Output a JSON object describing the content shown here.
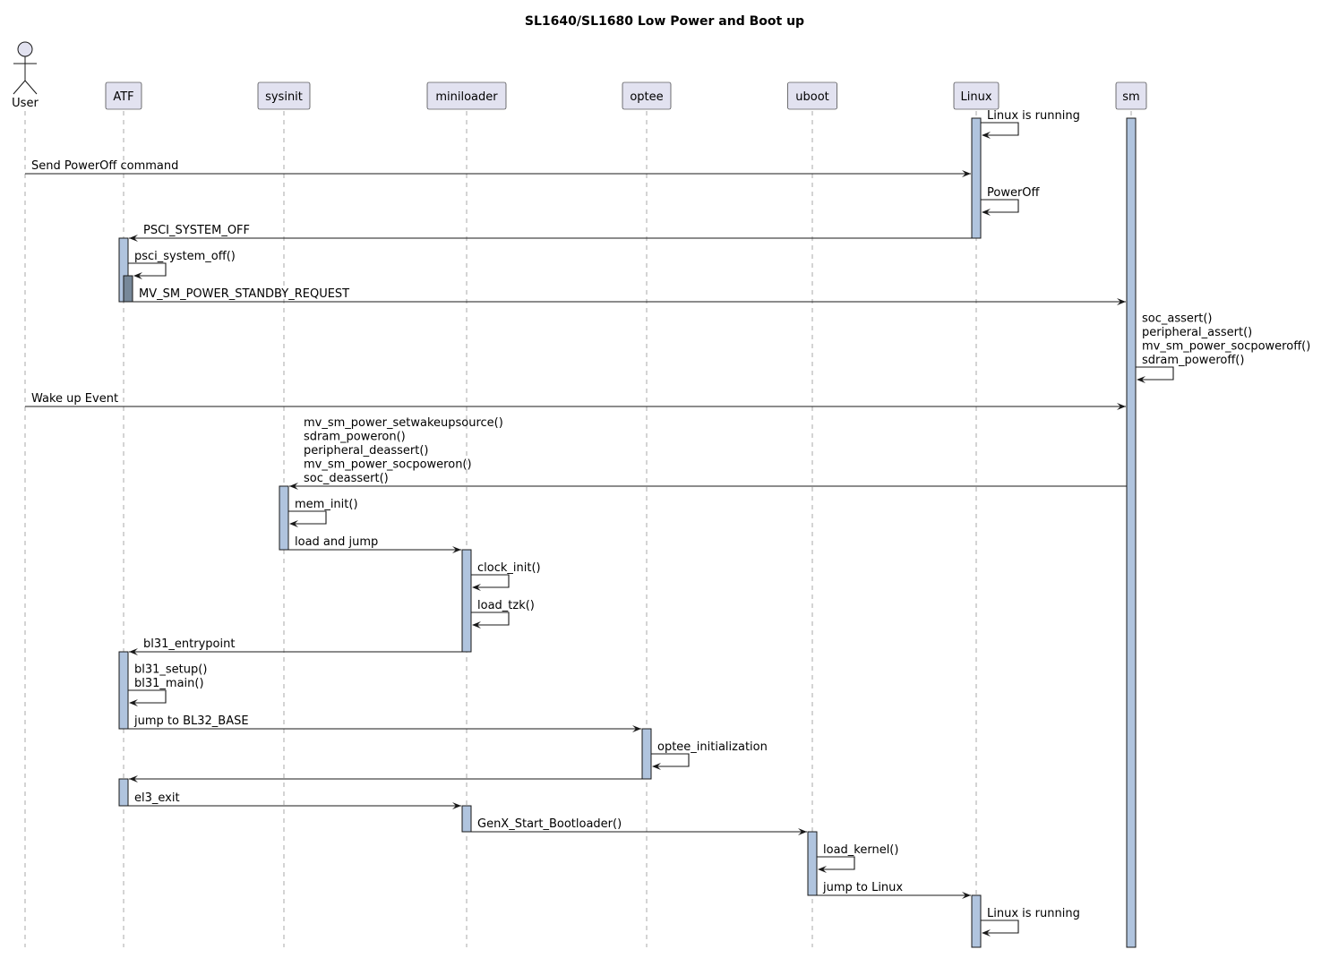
{
  "title": "SL1640/SL1680 Low Power and Boot up",
  "colors": {
    "participant_fill": "#e2e2f0",
    "activation_fill": "#b0c4de",
    "nested_activation_fill": "#778899",
    "line": "#181818"
  },
  "participants": [
    {
      "id": "user",
      "label": "User",
      "kind": "actor"
    },
    {
      "id": "atf",
      "label": "ATF",
      "kind": "participant"
    },
    {
      "id": "sysinit",
      "label": "sysinit",
      "kind": "participant"
    },
    {
      "id": "miniloader",
      "label": "miniloader",
      "kind": "participant"
    },
    {
      "id": "optee",
      "label": "optee",
      "kind": "participant"
    },
    {
      "id": "uboot",
      "label": "uboot",
      "kind": "participant"
    },
    {
      "id": "linux",
      "label": "Linux",
      "kind": "participant"
    },
    {
      "id": "sm",
      "label": "sm",
      "kind": "participant"
    }
  ],
  "messages": [
    {
      "from": "linux",
      "to": "linux",
      "lines": [
        "Linux is running"
      ]
    },
    {
      "from": "user",
      "to": "linux",
      "lines": [
        "Send PowerOff command"
      ]
    },
    {
      "from": "linux",
      "to": "linux",
      "lines": [
        "PowerOff"
      ]
    },
    {
      "from": "linux",
      "to": "atf",
      "lines": [
        "PSCI_SYSTEM_OFF"
      ]
    },
    {
      "from": "atf",
      "to": "atf",
      "lines": [
        "psci_system_off()"
      ]
    },
    {
      "from": "atf",
      "to": "sm",
      "lines": [
        "MV_SM_POWER_STANDBY_REQUEST"
      ]
    },
    {
      "from": "sm",
      "to": "sm",
      "lines": [
        "soc_assert()",
        "peripheral_assert()",
        "mv_sm_power_socpoweroff()",
        "sdram_poweroff()"
      ]
    },
    {
      "from": "user",
      "to": "sm",
      "lines": [
        "Wake up Event"
      ]
    },
    {
      "from": "sm",
      "to": "sysinit",
      "lines": [
        "mv_sm_power_setwakeupsource()",
        "sdram_poweron()",
        "peripheral_deassert()",
        "mv_sm_power_socpoweron()",
        "soc_deassert()"
      ]
    },
    {
      "from": "sysinit",
      "to": "sysinit",
      "lines": [
        "mem_init()"
      ]
    },
    {
      "from": "sysinit",
      "to": "miniloader",
      "lines": [
        "load and jump"
      ]
    },
    {
      "from": "miniloader",
      "to": "miniloader",
      "lines": [
        "clock_init()"
      ]
    },
    {
      "from": "miniloader",
      "to": "miniloader",
      "lines": [
        "load_tzk()"
      ]
    },
    {
      "from": "miniloader",
      "to": "atf",
      "lines": [
        "bl31_entrypoint"
      ]
    },
    {
      "from": "atf",
      "to": "atf",
      "lines": [
        "bl31_setup()",
        "bl31_main()"
      ]
    },
    {
      "from": "atf",
      "to": "optee",
      "lines": [
        "jump to BL32_BASE"
      ]
    },
    {
      "from": "optee",
      "to": "optee",
      "lines": [
        "optee_initialization"
      ]
    },
    {
      "from": "optee",
      "to": "atf",
      "lines": []
    },
    {
      "from": "atf",
      "to": "miniloader",
      "lines": [
        "el3_exit"
      ]
    },
    {
      "from": "miniloader",
      "to": "uboot",
      "lines": [
        "GenX_Start_Bootloader()"
      ]
    },
    {
      "from": "uboot",
      "to": "uboot",
      "lines": [
        "load_kernel()"
      ]
    },
    {
      "from": "uboot",
      "to": "linux",
      "lines": [
        "jump to Linux"
      ]
    },
    {
      "from": "linux",
      "to": "linux",
      "lines": [
        "Linux is running"
      ]
    }
  ]
}
